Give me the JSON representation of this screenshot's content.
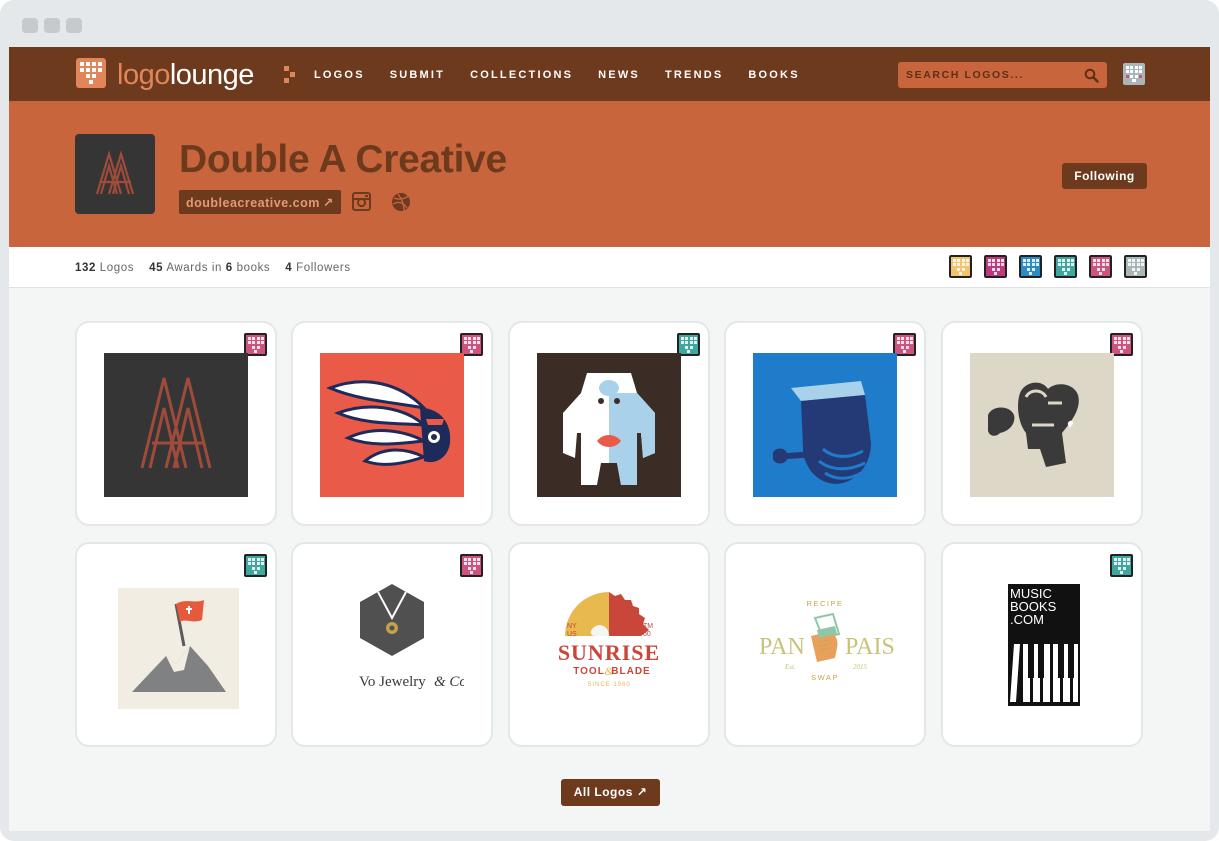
{
  "window": {
    "controls": [
      "close",
      "minimize",
      "maximize"
    ]
  },
  "nav": {
    "brand_prefix": "logo",
    "brand_suffix": "lounge",
    "items": [
      "LOGOS",
      "SUBMIT",
      "COLLECTIONS",
      "NEWS",
      "TRENDS",
      "BOOKS"
    ],
    "search_placeholder": "SEARCH LOGOS...",
    "search_icon": "magnifier",
    "user_icon": "pixel-avatar"
  },
  "profile": {
    "name": "Double A Creative",
    "website": "doubleacreative.com",
    "website_arrow": "↗",
    "social_icons": [
      "instagram",
      "dribbble"
    ],
    "follow_label": "Following"
  },
  "stats": {
    "logos_count": "132",
    "logos_label": "Logos",
    "awards_count": "45",
    "awards_label": "Awards in",
    "books_count": "6",
    "books_label": "books",
    "followers_count": "4",
    "followers_label": "Followers",
    "award_badge_colors": [
      "#f2c46d",
      "#c0397a",
      "#2a8cc2",
      "#3fa7a0",
      "#d0527f",
      "#a9b7b8"
    ]
  },
  "logos": [
    {
      "name": "Double A monogram",
      "badge_color": "#d0527f"
    },
    {
      "name": "Headdress",
      "badge_color": "#d0527f"
    },
    {
      "name": "Yeti",
      "badge_color": "#3fa7a0"
    },
    {
      "name": "Sailor with pipe",
      "badge_color": "#d0527f"
    },
    {
      "name": "Boxing heart",
      "badge_color": "#d0527f"
    },
    {
      "name": "Mountain flag",
      "badge_color": "#3fa7a0"
    },
    {
      "name": "Vo Jewelry",
      "badge_color": "#d0527f",
      "text_main": "Vo Jewelry",
      "text_amp": "& Co."
    },
    {
      "name": "Sunrise Tool & Blade",
      "badge_color": null,
      "text_title": "SUNRISE",
      "text_sub1": "TOOL",
      "text_amp": "&",
      "text_sub2": "BLADE",
      "text_since": "SINCE 1960",
      "text_ny": "NY",
      "text_us": "US",
      "text_tm": "TM",
      "text_60": "60"
    },
    {
      "name": "Pan Pals",
      "badge_color": null,
      "text_left": "PAN",
      "text_right": "PAIS",
      "text_top": "RECIPE",
      "text_bottom": "SWAP",
      "text_est": "Est.",
      "text_year": "2015"
    },
    {
      "name": "MusicBooks.com",
      "badge_color": "#3fa7a0",
      "text_lines": [
        "MUSIC",
        "BOOKS",
        ".COM"
      ]
    }
  ],
  "footer": {
    "all_logos_label": "All Logos",
    "all_logos_arrow": "↗"
  }
}
